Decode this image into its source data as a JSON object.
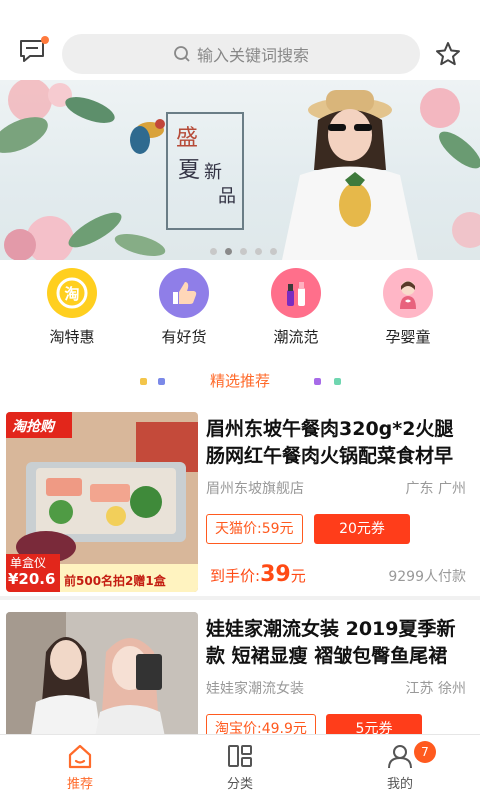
{
  "header": {
    "search_placeholder": "输入关键词搜索",
    "message_icon": "message-icon",
    "favorite_icon": "star-icon"
  },
  "banner": {
    "title_1": "盛",
    "title_2": "夏",
    "title_3": "新",
    "title_4": "品",
    "dots_count": 5,
    "active_dot": 2
  },
  "categories": [
    {
      "label": "淘特惠",
      "icon": "taote-icon"
    },
    {
      "label": "有好货",
      "icon": "thumbs-up-icon"
    },
    {
      "label": "潮流范",
      "icon": "makeup-icon"
    },
    {
      "label": "孕婴童",
      "icon": "pregnant-icon"
    }
  ],
  "section": {
    "title": "精选推荐"
  },
  "products": [
    {
      "title": "眉州东坡午餐肉320g*2火腿肠网红午餐肉火锅配菜食材早",
      "shop": "眉州东坡旗舰店",
      "location": "广东 广州",
      "platform_price": "天猫价:59元",
      "coupon": "20元券",
      "final_prefix": "到手价:",
      "final_price": "39",
      "final_suffix": "元",
      "sales": "9299人付款",
      "thumb_badge_top": "淘抢购",
      "thumb_badge_box": "单盒仪",
      "thumb_price": "¥20.6",
      "thumb_promo": "前500名拍2赠1盒"
    },
    {
      "title": "娃娃家潮流女装 2019夏季新款 短裙显瘦 褶皱包臀鱼尾裙",
      "shop": "娃娃家潮流女装",
      "location": "江苏 徐州",
      "platform_price": "淘宝价:49.9元",
      "coupon": "5元券"
    }
  ],
  "nav": [
    {
      "label": "推荐",
      "icon": "home-icon",
      "active": true
    },
    {
      "label": "分类",
      "icon": "grid-icon",
      "active": false
    },
    {
      "label": "我的",
      "icon": "user-icon",
      "active": false,
      "badge": "7"
    }
  ],
  "colors": {
    "accent": "#ff6a2a",
    "coupon": "#ff3d1a"
  }
}
